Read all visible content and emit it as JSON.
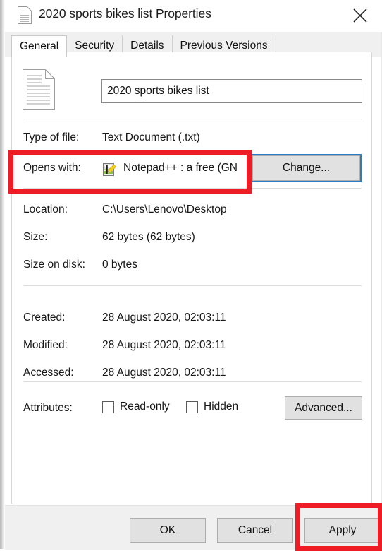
{
  "window": {
    "title": "2020 sports bikes list Properties",
    "title_icon": "text-document-icon",
    "close_label": "×"
  },
  "tabs": [
    {
      "label": "General",
      "active": true
    },
    {
      "label": "Security",
      "active": false
    },
    {
      "label": "Details",
      "active": false
    },
    {
      "label": "Previous Versions",
      "active": false
    }
  ],
  "general": {
    "file_icon": "text-document-icon",
    "name_value": "2020 sports bikes list",
    "rows": {
      "type": {
        "label": "Type of file:",
        "value": "Text Document (.txt)"
      },
      "opens_with": {
        "label": "Opens with:",
        "app_icon": "notepadpp-icon",
        "app_name": "Notepad++ : a free (GN",
        "change_button": "Change..."
      },
      "location": {
        "label": "Location:",
        "value": "C:\\Users\\Lenovo\\Desktop"
      },
      "size": {
        "label": "Size:",
        "value": "62 bytes (62 bytes)"
      },
      "size_on_disk": {
        "label": "Size on disk:",
        "value": "0 bytes"
      },
      "created": {
        "label": "Created:",
        "value": "28 August 2020, 02:03:11"
      },
      "modified": {
        "label": "Modified:",
        "value": "28 August 2020, 02:03:11"
      },
      "accessed": {
        "label": "Accessed:",
        "value": "28 August 2020, 02:03:11"
      }
    },
    "attributes": {
      "label": "Attributes:",
      "read_only": {
        "label": "Read-only",
        "checked": false
      },
      "hidden": {
        "label": "Hidden",
        "checked": false
      },
      "advanced_button": "Advanced..."
    }
  },
  "footer": {
    "ok": "OK",
    "cancel": "Cancel",
    "apply": "Apply"
  },
  "annotations": {
    "color": "#ee1c25",
    "targets": [
      "opens-with-row",
      "apply-button"
    ]
  },
  "colors": {
    "focus_ring": "#2b7cc6",
    "button_face": "#e1e1e1",
    "dialog_chrome": "#f0f0f0",
    "annotation_red": "#ee1c25"
  }
}
